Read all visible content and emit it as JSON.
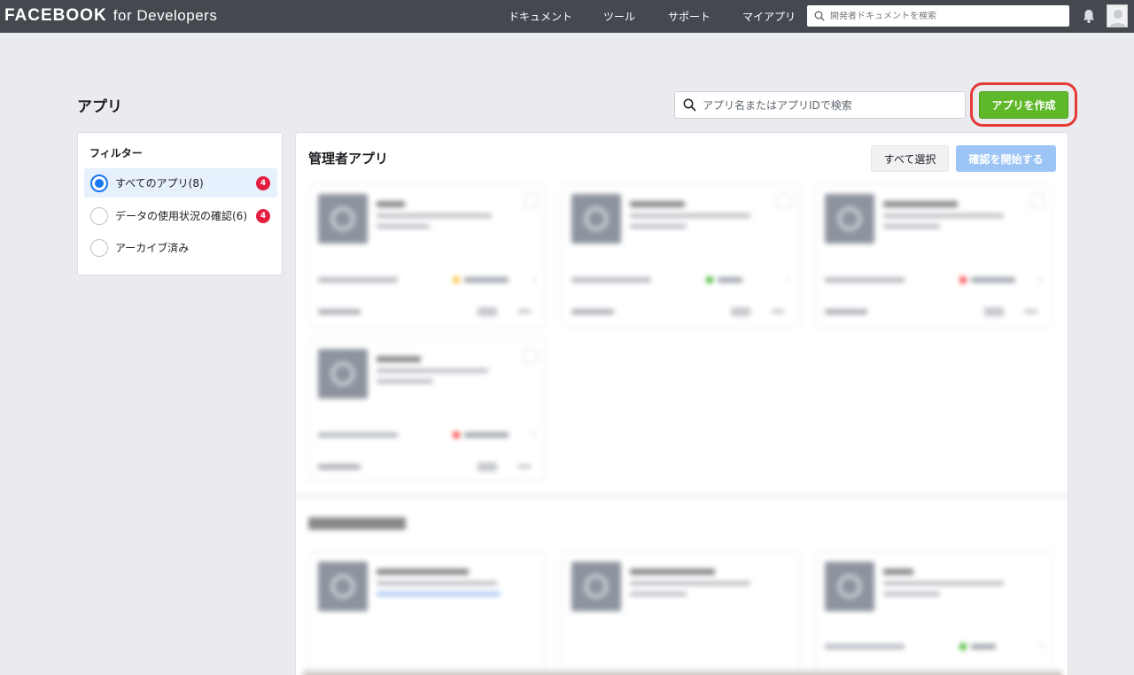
{
  "nav": {
    "logo_main": "FACEBOOK",
    "logo_sub": "for Developers",
    "links": [
      "ドキュメント",
      "ツール",
      "サポート",
      "マイアプリ"
    ],
    "search_placeholder": "開発者ドキュメントを検索"
  },
  "page": {
    "title": "アプリ",
    "search_placeholder": "アプリ名またはアプリIDで検索",
    "create_button": "アプリを作成"
  },
  "filter": {
    "title": "フィルター",
    "items": [
      {
        "label": "すべてのアプリ(8)",
        "badge": "4",
        "selected": true
      },
      {
        "label": "データの使用状況の確認(6)",
        "badge": "4",
        "selected": false
      },
      {
        "label": "アーカイブ済み",
        "badge": "",
        "selected": false
      }
    ]
  },
  "main": {
    "section_title": "管理者アプリ",
    "select_all": "すべて選択",
    "start_review": "確認を開始する"
  },
  "colors": {
    "accent": "#5fb82a",
    "highlight": "#e53935",
    "badge": "#e41e3f",
    "nav_bg": "#444950"
  }
}
